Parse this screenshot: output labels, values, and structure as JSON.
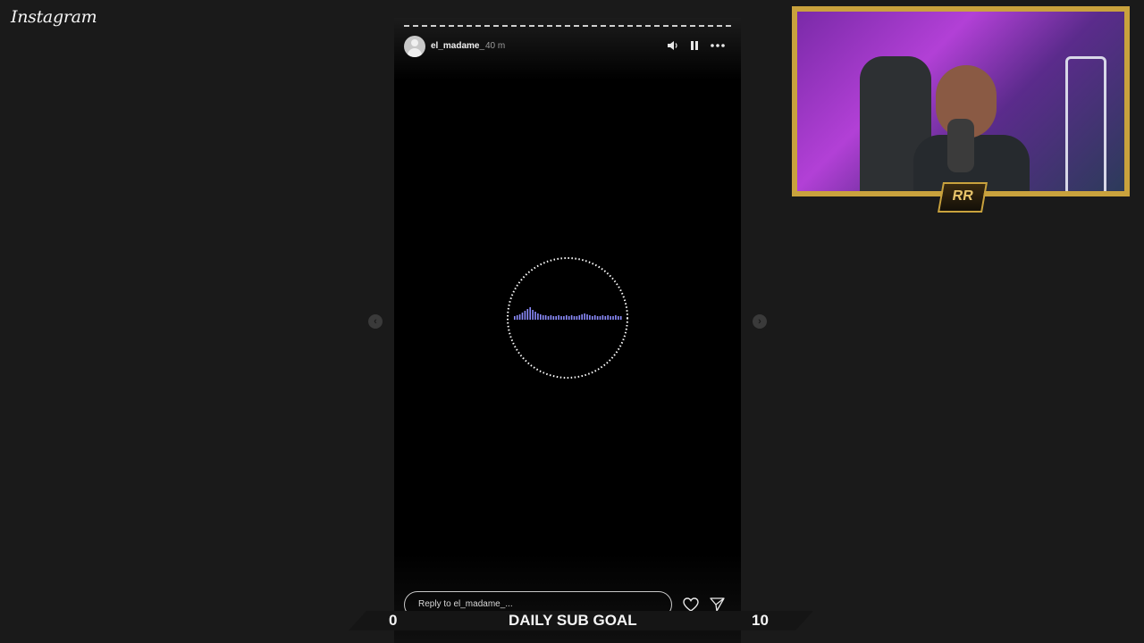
{
  "app": {
    "logo_text": "Instagram"
  },
  "story": {
    "username": "el_madame_",
    "time_ago": "40 m",
    "reply_placeholder": "Reply to el_madame_..."
  },
  "icons": {
    "mute": "volume-icon",
    "pause": "pause-icon",
    "more": "more-icon",
    "like": "heart-icon",
    "share": "send-icon",
    "prev": "chevron-left-icon",
    "next": "chevron-right-icon"
  },
  "overlay": {
    "badge_text": "RR",
    "sub_goal": {
      "label": "DAILY SUB GOAL",
      "current": "0",
      "target": "10"
    }
  },
  "colors": {
    "frame_gold": "#c9a23d",
    "waveform": "#8c8cff"
  }
}
